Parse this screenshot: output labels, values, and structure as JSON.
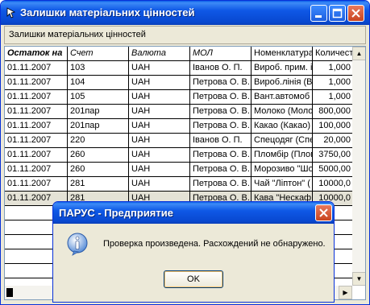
{
  "window": {
    "title": "Залишки матеріальних цінностей"
  },
  "toolbar": {
    "label": "Залишки матеріальних цінностей"
  },
  "table": {
    "headers": [
      "Остаток на",
      "Счет",
      "Валюта",
      "МОЛ",
      "Номенклатура",
      "Количество"
    ],
    "rows": [
      [
        "01.11.2007",
        "103",
        "UAH",
        "Іванов О. П.",
        "Вироб. прим. і",
        "1,000"
      ],
      [
        "01.11.2007",
        "104",
        "UAH",
        "Петрова О. В.",
        "Вироб.лінія (Ві",
        "1,000"
      ],
      [
        "01.11.2007",
        "105",
        "UAH",
        "Петрова О. В.",
        "Вант.автомоб",
        "1,000"
      ],
      [
        "01.11.2007",
        "201пар",
        "UAH",
        "Петрова О. В.",
        "Молоко (Моло",
        "800,000"
      ],
      [
        "01.11.2007",
        "201пар",
        "UAH",
        "Петрова О. В.",
        "Какао (Какао)",
        "100,000"
      ],
      [
        "01.11.2007",
        "220",
        "UAH",
        "Іванов О. П.",
        "Спецодяг (Спе",
        "20,000"
      ],
      [
        "01.11.2007",
        "260",
        "UAH",
        "Петрова О. В.",
        "Пломбір (Плом",
        "3750,00"
      ],
      [
        "01.11.2007",
        "260",
        "UAH",
        "Петрова О. В.",
        "Морозиво \"Шо",
        "5000,00"
      ],
      [
        "01.11.2007",
        "281",
        "UAH",
        "Петрова О. В.",
        "Чай \"Ліптон\" (",
        "10000,0"
      ],
      [
        "01.11.2007",
        "281",
        "UAH",
        "Петрова О. В.",
        "Кава \"Нескаф",
        "10000,0"
      ]
    ]
  },
  "dialog": {
    "title": "ПАРУС - Предприятие",
    "message": "Проверка произведена. Расхождений не обнаружено.",
    "ok_label": "OK"
  }
}
